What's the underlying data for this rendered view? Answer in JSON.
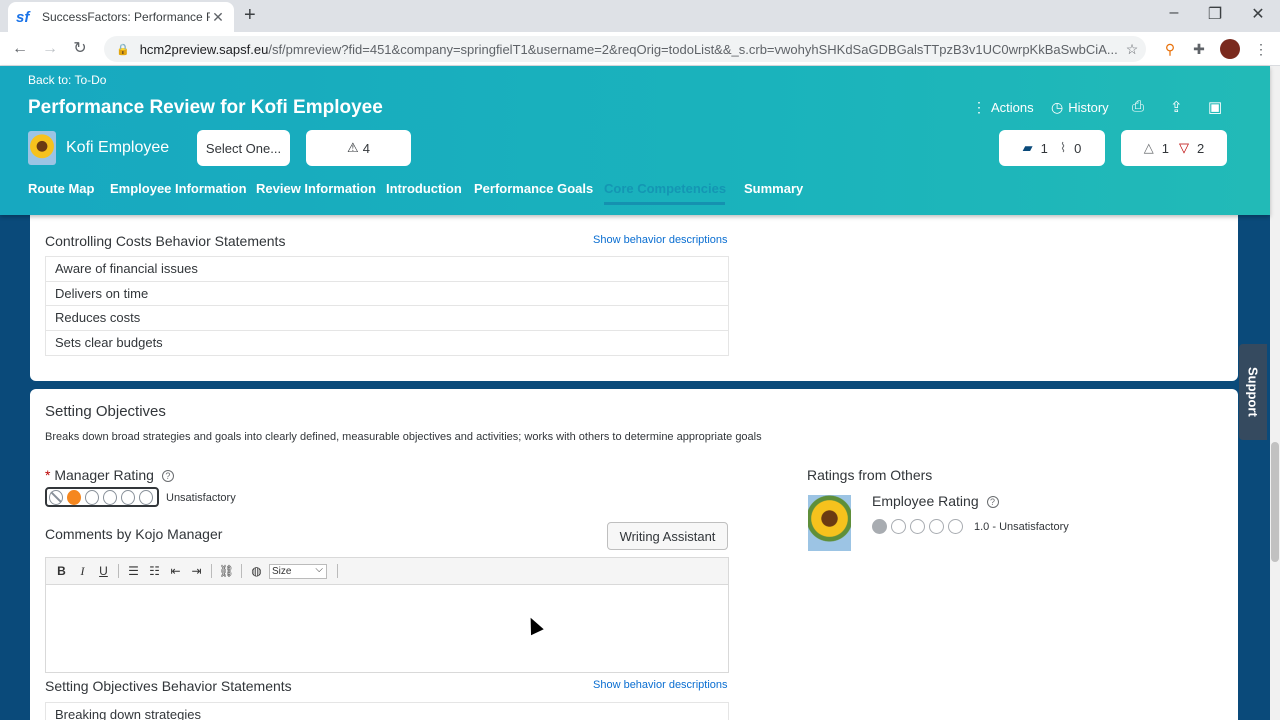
{
  "browser": {
    "tab_title": "SuccessFactors: Performance Rev",
    "tab_favicon": "sf",
    "url_host": "hcm2preview.sapsf.eu",
    "url_path": "/sf/pmreview?fid=451&company=springfielT1&username=2&reqOrig=todoList&&_s.crb=vwohyhSHKdSaGDBGalsTTpzB3v1UC0wrpKkBaSwbCiA..."
  },
  "header": {
    "back_link": "Back to: To-Do",
    "title": "Performance Review for Kofi Employee",
    "employee_name": "Kofi Employee",
    "select_label": "Select One...",
    "alert_count": "4",
    "actions_label": "Actions",
    "history_label": "History",
    "comments_count": "1",
    "attachments_count": "0",
    "warnings_count": "1",
    "errors_count": "2"
  },
  "nav": {
    "items": [
      "Route Map",
      "Employee Information",
      "Review Information",
      "Introduction",
      "Performance Goals",
      "Core Competencies",
      "Summary"
    ],
    "active": "Core Competencies"
  },
  "controlling_costs": {
    "heading": "Controlling Costs Behavior Statements",
    "show_link": "Show behavior descriptions",
    "items": [
      "Aware of financial issues",
      "Delivers on time",
      "Reduces costs",
      "Sets clear budgets"
    ]
  },
  "setting_objectives": {
    "title": "Setting Objectives",
    "description": "Breaks down broad strategies and goals into clearly defined, measurable objectives and activities; works with others to determine appropriate goals",
    "required_mark": "*",
    "manager_rating_label": "Manager Rating",
    "manager_rating_value": 1,
    "manager_rating_max": 5,
    "manager_rating_text": "Unsatisfactory",
    "comments_label": "Comments by Kojo Manager",
    "writing_assistant": "Writing Assistant",
    "size_select": "Size",
    "ratings_from_others": "Ratings from Others",
    "employee_rating_label": "Employee Rating",
    "employee_rating_value": 1,
    "employee_rating_text": "1.0 - Unsatisfactory",
    "behavior_heading": "Setting Objectives Behavior Statements",
    "show_link": "Show behavior descriptions",
    "first_item": "Breaking down strategies"
  },
  "support_label": "Support"
}
